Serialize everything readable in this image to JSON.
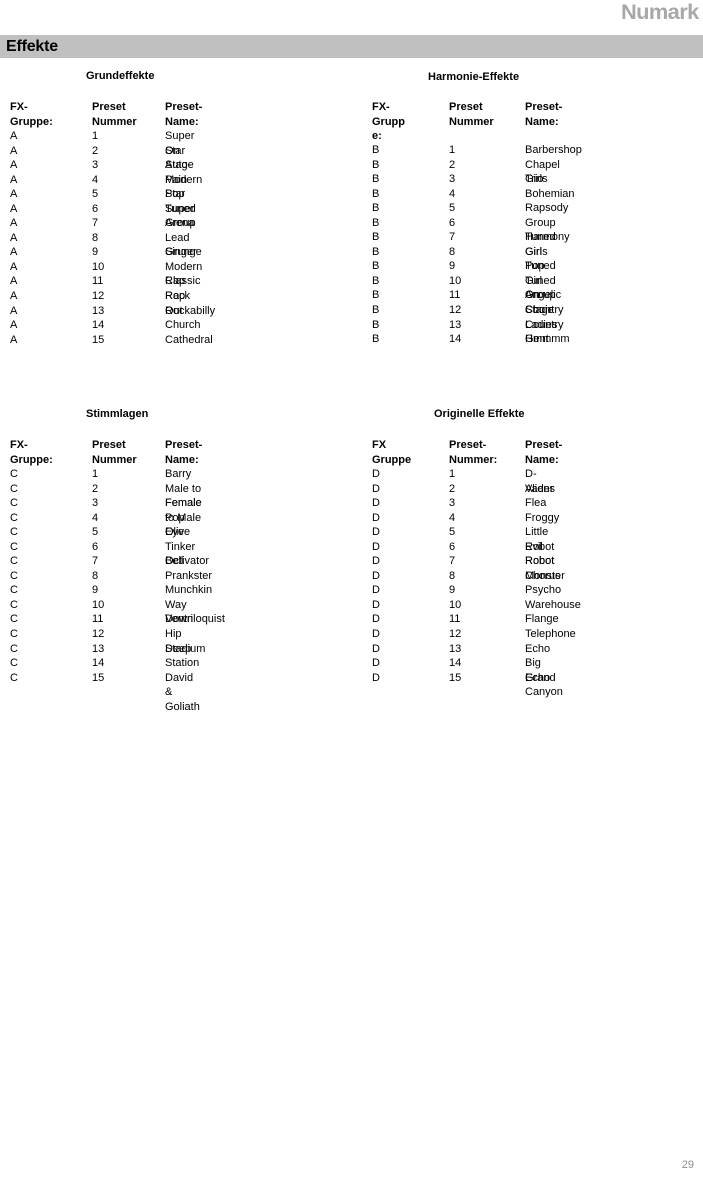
{
  "brand": {
    "logo_text": "Numark"
  },
  "banner": {
    "title": "Effekte"
  },
  "footer": {
    "page_number": "29"
  },
  "blocks": [
    {
      "title": "Grundeffekte",
      "headers": {
        "group": "FX-\nGruppe:",
        "number": "Preset\nNummer",
        "name": "Preset-Name:"
      },
      "rows": [
        {
          "group": "A",
          "number": "1",
          "name": "Super Star"
        },
        {
          "group": "A",
          "number": "2",
          "name": "On Stage"
        },
        {
          "group": "A",
          "number": "3",
          "name": "Auto-Pain"
        },
        {
          "group": "A",
          "number": "4",
          "name": "Modern Pop Tuned"
        },
        {
          "group": "A",
          "number": "5",
          "name": "Star"
        },
        {
          "group": "A",
          "number": "6",
          "name": "Super Group"
        },
        {
          "group": "A",
          "number": "7",
          "name": "Arena"
        },
        {
          "group": "A",
          "number": "8",
          "name": "Lead Singer"
        },
        {
          "group": "A",
          "number": "9",
          "name": "Grunge"
        },
        {
          "group": "A",
          "number": "10",
          "name": "Modern Rap"
        },
        {
          "group": "A",
          "number": "11",
          "name": "Classic Rap"
        },
        {
          "group": "A",
          "number": "12",
          "name": "Rock Out"
        },
        {
          "group": "A",
          "number": "13",
          "name": "Rockabilly"
        },
        {
          "group": "A",
          "number": "14",
          "name": "Church"
        },
        {
          "group": "A",
          "number": "15",
          "name": "Cathedral"
        }
      ]
    },
    {
      "title": "Harmonie-Effekte",
      "headers": {
        "group": "FX-\nGrupp\ne:",
        "number": "Preset\nNummer",
        "name": "Preset-Name:"
      },
      "rows": [
        {
          "group": "B",
          "number": "1",
          "name": "Barbershop"
        },
        {
          "group": "B",
          "number": "2",
          "name": "Chapel Girls"
        },
        {
          "group": "B",
          "number": "3",
          "name": "Trio"
        },
        {
          "group": "B",
          "number": "4",
          "name": "Bohemian"
        },
        {
          "group": "B",
          "number": "5",
          "name": "Rapsody"
        },
        {
          "group": "B",
          "number": "6",
          "name": "Group Harmony"
        },
        {
          "group": "B",
          "number": "7",
          "name": "Tuned Girls"
        },
        {
          "group": "B",
          "number": "8",
          "name": "Girl Pop"
        },
        {
          "group": "B",
          "number": "9",
          "name": "Tuned Girl Group"
        },
        {
          "group": "B",
          "number": "10",
          "name": "Tuned On Stage"
        },
        {
          "group": "B",
          "number": "11",
          "name": "Angelic Choir"
        },
        {
          "group": "B",
          "number": "12",
          "name": "Country Ladies"
        },
        {
          "group": "B",
          "number": "13",
          "name": "Country Gent"
        },
        {
          "group": "B",
          "number": "14",
          "name": "Hmmmm"
        }
      ]
    },
    {
      "title": "Stimmlagen",
      "headers": {
        "group": "FX-\nGruppe:",
        "number": "Preset\nNummer",
        "name": "Preset-Name:"
      },
      "rows": [
        {
          "group": "C",
          "number": "1",
          "name": "Barry"
        },
        {
          "group": "C",
          "number": "2",
          "name": "Male to Female"
        },
        {
          "group": "C",
          "number": "3",
          "name": "Female to Male"
        },
        {
          "group": "C",
          "number": "4",
          "name": "Pop Eye"
        },
        {
          "group": "C",
          "number": "5",
          "name": "Olive"
        },
        {
          "group": "C",
          "number": "6",
          "name": "Tinker Bell"
        },
        {
          "group": "C",
          "number": "7",
          "name": "Octivator"
        },
        {
          "group": "C",
          "number": "8",
          "name": "Prankster"
        },
        {
          "group": "C",
          "number": "9",
          "name": "Munchkin"
        },
        {
          "group": "C",
          "number": "10",
          "name": "Way Down"
        },
        {
          "group": "C",
          "number": "11",
          "name": "Ventriloquist"
        },
        {
          "group": "C",
          "number": "12",
          "name": "Hip Deep"
        },
        {
          "group": "C",
          "number": "13",
          "name": "Stadium"
        },
        {
          "group": "C",
          "number": "14",
          "name": "Station"
        },
        {
          "group": "C",
          "number": "15",
          "name": "David & Goliath"
        }
      ]
    },
    {
      "title": "Originelle Effekte",
      "headers": {
        "group": "FX\nGruppe",
        "number": "Preset-\nNummer:",
        "name": "Preset-Name:"
      },
      "rows": [
        {
          "group": "D",
          "number": "1",
          "name": "D-Vader"
        },
        {
          "group": "D",
          "number": "2",
          "name": "Aliens"
        },
        {
          "group": "D",
          "number": "3",
          "name": "Flea"
        },
        {
          "group": "D",
          "number": "4",
          "name": "Froggy"
        },
        {
          "group": "D",
          "number": "5",
          "name": "Little Robot"
        },
        {
          "group": "D",
          "number": "6",
          "name": "Evil Robot"
        },
        {
          "group": "D",
          "number": "7",
          "name": "Robot Chorus"
        },
        {
          "group": "D",
          "number": "8",
          "name": "Monster"
        },
        {
          "group": "D",
          "number": "9",
          "name": "Psycho"
        },
        {
          "group": "D",
          "number": "10",
          "name": "Warehouse"
        },
        {
          "group": "D",
          "number": "11",
          "name": "Flange"
        },
        {
          "group": "D",
          "number": "12",
          "name": "Telephone"
        },
        {
          "group": "D",
          "number": "13",
          "name": "Echo"
        },
        {
          "group": "D",
          "number": "14",
          "name": "Big Echo"
        },
        {
          "group": "D",
          "number": "15",
          "name": "Grand Canyon"
        }
      ]
    }
  ],
  "colors": {
    "banner_background": "#c0c0c0",
    "logo": "#a8a8a8",
    "text": "#000000",
    "page_number": "#8c8c8c"
  }
}
